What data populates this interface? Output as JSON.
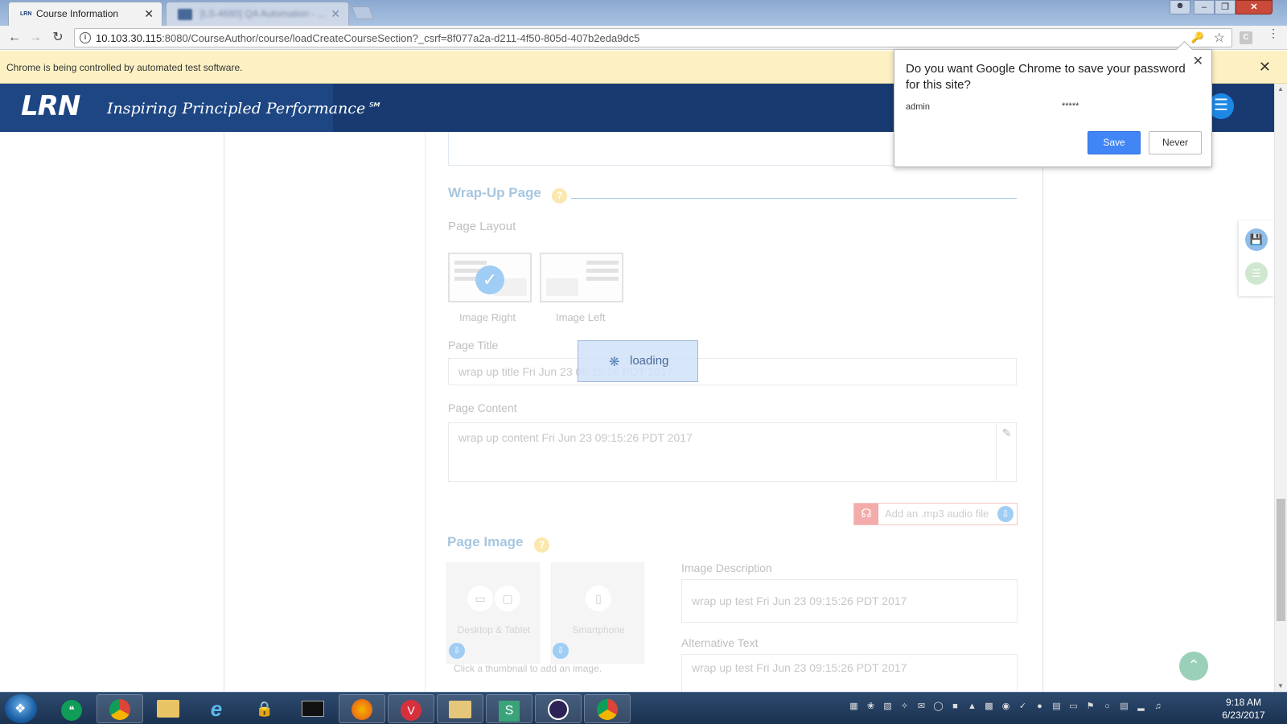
{
  "browser": {
    "active_tab_title": "Course Information",
    "inactive_tab_title": "[LS-4680] QA Automation - ...",
    "url_host": "10.103.30.115",
    "url_rest": ":8080/CourseAuthor/course/loadCreateCourseSection?_csrf=8f077a2a-d211-4f50-805d-407b2eda9dc5",
    "infobar_text": "Chrome is being controlled by automated test software.",
    "tab_close": "✕",
    "infobar_close": "✕"
  },
  "password_prompt": {
    "title": "Do you want Google Chrome to save your password for this site?",
    "username": "admin",
    "password_mask": "*****",
    "save_label": "Save",
    "never_label": "Never",
    "close": "✕"
  },
  "header": {
    "logo": "LRN",
    "tagline": "Inspiring Principled Performance℠"
  },
  "wrapup": {
    "section_title": "Wrap-Up Page",
    "help": "?",
    "page_layout_label": "Page Layout",
    "layout_options": [
      "Image Right",
      "Image Left"
    ],
    "page_title_label": "Page Title",
    "page_title_value": "wrap up title Fri Jun 23 09:15:26 PDT 2017",
    "page_content_label": "Page Content",
    "page_content_value": "wrap up content Fri Jun 23 09:15:26 PDT 2017",
    "audio_label": "Add an .mp3 audio file"
  },
  "page_image": {
    "section_title": "Page Image",
    "help": "?",
    "cards": [
      "Desktop & Tablet",
      "Smartphone"
    ],
    "hint": "Click a thumbnail to add an image.",
    "image_description_label": "Image Description",
    "image_description_value": "wrap up test Fri Jun 23 09:15:26 PDT 2017",
    "alt_text_label": "Alternative Text",
    "alt_text_value": "wrap up test Fri Jun 23 09:15:26 PDT 2017"
  },
  "loading": {
    "text": "loading"
  },
  "taskbar": {
    "time": "9:18 AM",
    "date": "6/23/2017"
  },
  "colors": {
    "header_bg": "#183a71",
    "accent_blue": "#2d78b4",
    "save_button": "#4285f4",
    "infobar_bg": "#fdf1c4"
  }
}
